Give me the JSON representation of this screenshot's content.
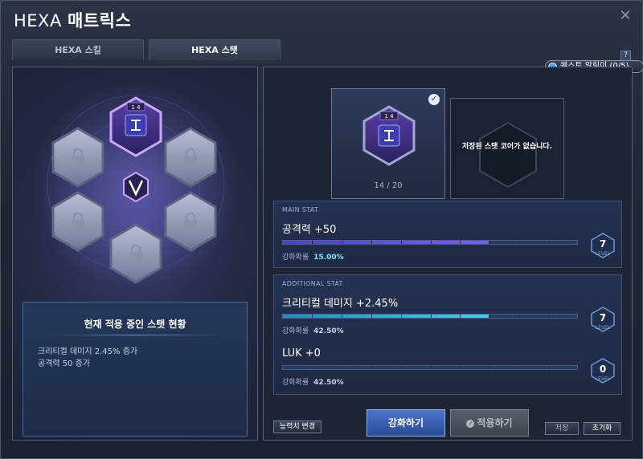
{
  "window": {
    "title_plain": "HEXA ",
    "title_bold": "매트릭스",
    "close_glyph": "✕"
  },
  "tabs": [
    {
      "label": "HEXA 스킬"
    },
    {
      "label": "HEXA 스탯"
    }
  ],
  "help_glyph": "?",
  "quest_alert": "퀘스트 알림이 (0/5)",
  "left_panel": {
    "core_level": "1 4",
    "status": {
      "title": "현재 적용 중인 스탯 현황",
      "lines": [
        "크리티컬 데미지 2.45% 증가",
        "공격력 50 증가"
      ]
    }
  },
  "right_panel": {
    "core": {
      "level": "1 4",
      "count": "14 / 20",
      "check_glyph": "✓"
    },
    "empty_slot_text": "저장된 스탯 코어가 없습니다.",
    "main_stat": {
      "section_label": "MAIN STAT",
      "name": "공격력 +50",
      "prob_label": "강화확률",
      "prob_value": "15.00%",
      "level": "7",
      "level_label": "LEVEL",
      "fill_fraction": 0.7
    },
    "additional_stat": {
      "section_label": "ADDITIONAL STAT",
      "stats": [
        {
          "name": "크리티컬 데미지 +2.45%",
          "prob_label": "강화확률",
          "prob_value": "42.50%",
          "level": "7",
          "level_label": "LEVEL",
          "fill_fraction": 0.7
        },
        {
          "name": "LUK +0",
          "prob_label": "강화확률",
          "prob_value": "42.50%",
          "level": "0",
          "level_label": "LEVEL",
          "fill_fraction": 0
        }
      ]
    },
    "buttons": {
      "reroll": "능력치 변경",
      "enhance": "강화하기",
      "apply": "적용하기",
      "save": "저장",
      "reset": "초기화"
    }
  },
  "colors": {
    "accent_violet": "#7a5cff",
    "accent_cyan": "#3fd0f0",
    "prob_main": "#7ee3ff"
  }
}
